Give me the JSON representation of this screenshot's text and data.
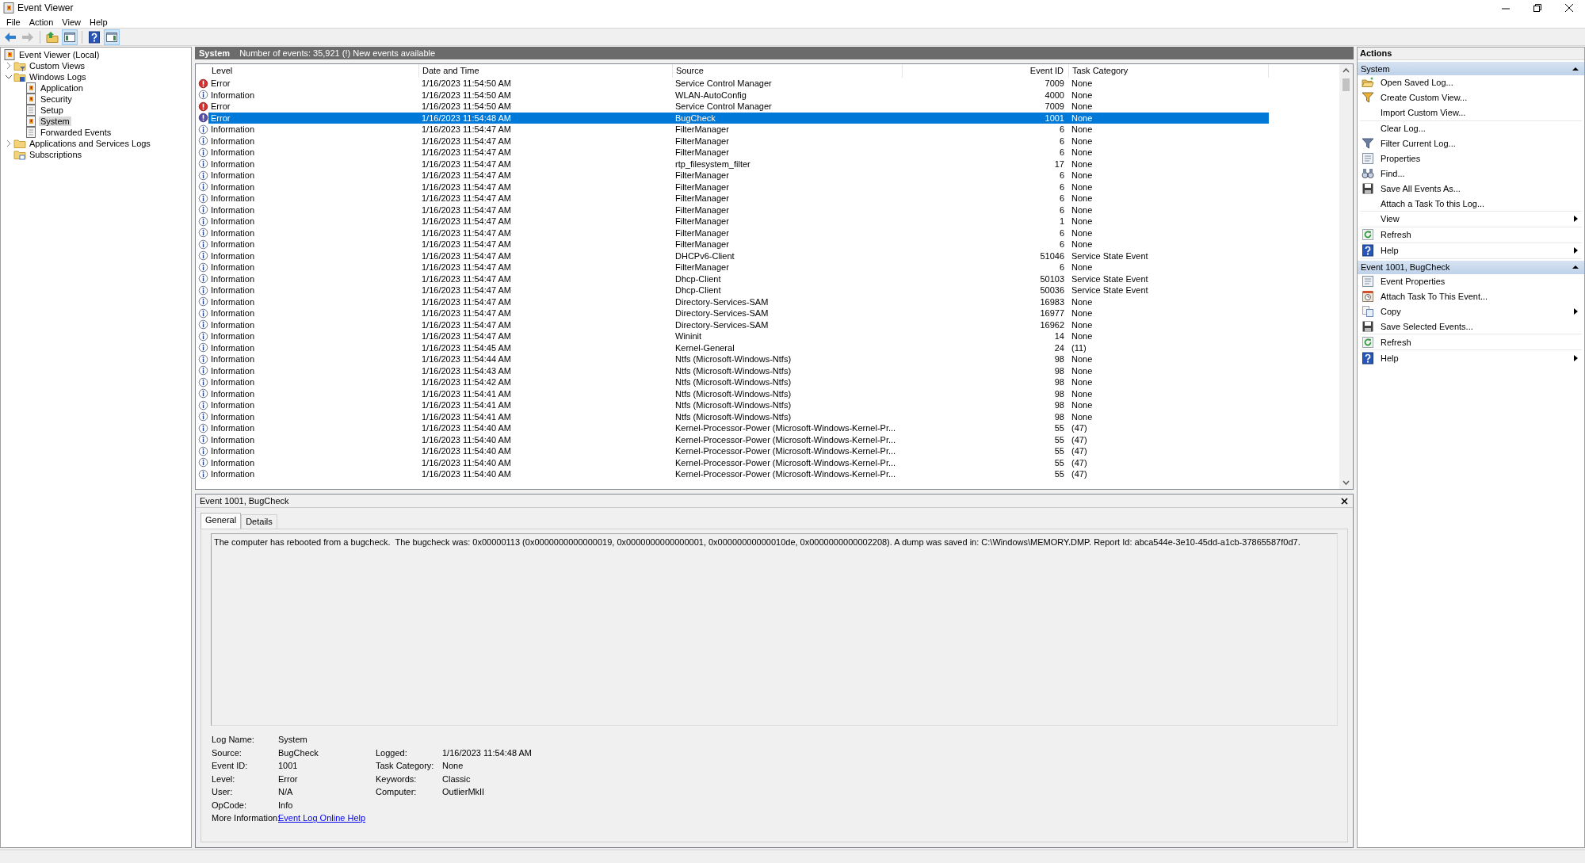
{
  "window": {
    "title": "Event Viewer"
  },
  "menu": [
    {
      "label": "File"
    },
    {
      "label": "Action"
    },
    {
      "label": "View"
    },
    {
      "label": "Help"
    }
  ],
  "toolbar": [
    {
      "kind": "back",
      "disabled": false,
      "pressed": false
    },
    {
      "kind": "forward",
      "disabled": true,
      "pressed": false
    },
    {
      "kind": "up",
      "disabled": false,
      "pressed": false
    },
    {
      "kind": "tree-pane",
      "disabled": false,
      "pressed": true
    },
    {
      "kind": "help",
      "disabled": false,
      "pressed": false
    },
    {
      "kind": "action-pane",
      "disabled": false,
      "pressed": true
    }
  ],
  "tree": {
    "items": [
      {
        "label": "Event Viewer (Local)",
        "kind": "root",
        "selected": false,
        "children": [
          {
            "label": "Custom Views",
            "kind": "filter-folder",
            "selected": false,
            "expanded": false
          },
          {
            "label": "Windows Logs",
            "kind": "logs-folder",
            "selected": false,
            "expanded": true,
            "children": [
              {
                "label": "Application",
                "kind": "log",
                "selected": false
              },
              {
                "label": "Security",
                "kind": "log",
                "selected": false
              },
              {
                "label": "Setup",
                "kind": "plain-log",
                "selected": false
              },
              {
                "label": "System",
                "kind": "log",
                "selected": true
              },
              {
                "label": "Forwarded Events",
                "kind": "plain-log",
                "selected": false
              }
            ]
          },
          {
            "label": "Applications and Services Logs",
            "kind": "folder",
            "selected": false,
            "expanded": false
          },
          {
            "label": "Subscriptions",
            "kind": "subscriptions",
            "selected": false
          }
        ]
      }
    ]
  },
  "events": {
    "title": "System",
    "summary": "Number of events: 35,921 (!) New events available",
    "columns": [
      "Level",
      "Date and Time",
      "Source",
      "Event ID",
      "Task Category"
    ],
    "rows": [
      {
        "kind": "error",
        "level": "Error",
        "date": "1/16/2023 11:54:50 AM",
        "source": "Service Control Manager",
        "event_id": "7009",
        "task_category": "None",
        "selected": false
      },
      {
        "kind": "info",
        "level": "Information",
        "date": "1/16/2023 11:54:50 AM",
        "source": "WLAN-AutoConfig",
        "event_id": "4000",
        "task_category": "None",
        "selected": false
      },
      {
        "kind": "error",
        "level": "Error",
        "date": "1/16/2023 11:54:50 AM",
        "source": "Service Control Manager",
        "event_id": "7009",
        "task_category": "None",
        "selected": false
      },
      {
        "kind": "error",
        "level": "Error",
        "date": "1/16/2023 11:54:48 AM",
        "source": "BugCheck",
        "event_id": "1001",
        "task_category": "None",
        "selected": true
      },
      {
        "kind": "info",
        "level": "Information",
        "date": "1/16/2023 11:54:47 AM",
        "source": "FilterManager",
        "event_id": "6",
        "task_category": "None",
        "selected": false
      },
      {
        "kind": "info",
        "level": "Information",
        "date": "1/16/2023 11:54:47 AM",
        "source": "FilterManager",
        "event_id": "6",
        "task_category": "None",
        "selected": false
      },
      {
        "kind": "info",
        "level": "Information",
        "date": "1/16/2023 11:54:47 AM",
        "source": "FilterManager",
        "event_id": "6",
        "task_category": "None",
        "selected": false
      },
      {
        "kind": "info",
        "level": "Information",
        "date": "1/16/2023 11:54:47 AM",
        "source": "rtp_filesystem_filter",
        "event_id": "17",
        "task_category": "None",
        "selected": false
      },
      {
        "kind": "info",
        "level": "Information",
        "date": "1/16/2023 11:54:47 AM",
        "source": "FilterManager",
        "event_id": "6",
        "task_category": "None",
        "selected": false
      },
      {
        "kind": "info",
        "level": "Information",
        "date": "1/16/2023 11:54:47 AM",
        "source": "FilterManager",
        "event_id": "6",
        "task_category": "None",
        "selected": false
      },
      {
        "kind": "info",
        "level": "Information",
        "date": "1/16/2023 11:54:47 AM",
        "source": "FilterManager",
        "event_id": "6",
        "task_category": "None",
        "selected": false
      },
      {
        "kind": "info",
        "level": "Information",
        "date": "1/16/2023 11:54:47 AM",
        "source": "FilterManager",
        "event_id": "6",
        "task_category": "None",
        "selected": false
      },
      {
        "kind": "info",
        "level": "Information",
        "date": "1/16/2023 11:54:47 AM",
        "source": "FilterManager",
        "event_id": "1",
        "task_category": "None",
        "selected": false
      },
      {
        "kind": "info",
        "level": "Information",
        "date": "1/16/2023 11:54:47 AM",
        "source": "FilterManager",
        "event_id": "6",
        "task_category": "None",
        "selected": false
      },
      {
        "kind": "info",
        "level": "Information",
        "date": "1/16/2023 11:54:47 AM",
        "source": "FilterManager",
        "event_id": "6",
        "task_category": "None",
        "selected": false
      },
      {
        "kind": "info",
        "level": "Information",
        "date": "1/16/2023 11:54:47 AM",
        "source": "DHCPv6-Client",
        "event_id": "51046",
        "task_category": "Service State Event",
        "selected": false
      },
      {
        "kind": "info",
        "level": "Information",
        "date": "1/16/2023 11:54:47 AM",
        "source": "FilterManager",
        "event_id": "6",
        "task_category": "None",
        "selected": false
      },
      {
        "kind": "info",
        "level": "Information",
        "date": "1/16/2023 11:54:47 AM",
        "source": "Dhcp-Client",
        "event_id": "50103",
        "task_category": "Service State Event",
        "selected": false
      },
      {
        "kind": "info",
        "level": "Information",
        "date": "1/16/2023 11:54:47 AM",
        "source": "Dhcp-Client",
        "event_id": "50036",
        "task_category": "Service State Event",
        "selected": false
      },
      {
        "kind": "info",
        "level": "Information",
        "date": "1/16/2023 11:54:47 AM",
        "source": "Directory-Services-SAM",
        "event_id": "16983",
        "task_category": "None",
        "selected": false
      },
      {
        "kind": "info",
        "level": "Information",
        "date": "1/16/2023 11:54:47 AM",
        "source": "Directory-Services-SAM",
        "event_id": "16977",
        "task_category": "None",
        "selected": false
      },
      {
        "kind": "info",
        "level": "Information",
        "date": "1/16/2023 11:54:47 AM",
        "source": "Directory-Services-SAM",
        "event_id": "16962",
        "task_category": "None",
        "selected": false
      },
      {
        "kind": "info",
        "level": "Information",
        "date": "1/16/2023 11:54:47 AM",
        "source": "Wininit",
        "event_id": "14",
        "task_category": "None",
        "selected": false
      },
      {
        "kind": "info",
        "level": "Information",
        "date": "1/16/2023 11:54:45 AM",
        "source": "Kernel-General",
        "event_id": "24",
        "task_category": "(11)",
        "selected": false
      },
      {
        "kind": "info",
        "level": "Information",
        "date": "1/16/2023 11:54:44 AM",
        "source": "Ntfs (Microsoft-Windows-Ntfs)",
        "event_id": "98",
        "task_category": "None",
        "selected": false
      },
      {
        "kind": "info",
        "level": "Information",
        "date": "1/16/2023 11:54:43 AM",
        "source": "Ntfs (Microsoft-Windows-Ntfs)",
        "event_id": "98",
        "task_category": "None",
        "selected": false
      },
      {
        "kind": "info",
        "level": "Information",
        "date": "1/16/2023 11:54:42 AM",
        "source": "Ntfs (Microsoft-Windows-Ntfs)",
        "event_id": "98",
        "task_category": "None",
        "selected": false
      },
      {
        "kind": "info",
        "level": "Information",
        "date": "1/16/2023 11:54:41 AM",
        "source": "Ntfs (Microsoft-Windows-Ntfs)",
        "event_id": "98",
        "task_category": "None",
        "selected": false
      },
      {
        "kind": "info",
        "level": "Information",
        "date": "1/16/2023 11:54:41 AM",
        "source": "Ntfs (Microsoft-Windows-Ntfs)",
        "event_id": "98",
        "task_category": "None",
        "selected": false
      },
      {
        "kind": "info",
        "level": "Information",
        "date": "1/16/2023 11:54:41 AM",
        "source": "Ntfs (Microsoft-Windows-Ntfs)",
        "event_id": "98",
        "task_category": "None",
        "selected": false
      },
      {
        "kind": "info",
        "level": "Information",
        "date": "1/16/2023 11:54:40 AM",
        "source": "Kernel-Processor-Power (Microsoft-Windows-Kernel-Pr...",
        "event_id": "55",
        "task_category": "(47)",
        "selected": false
      },
      {
        "kind": "info",
        "level": "Information",
        "date": "1/16/2023 11:54:40 AM",
        "source": "Kernel-Processor-Power (Microsoft-Windows-Kernel-Pr...",
        "event_id": "55",
        "task_category": "(47)",
        "selected": false
      },
      {
        "kind": "info",
        "level": "Information",
        "date": "1/16/2023 11:54:40 AM",
        "source": "Kernel-Processor-Power (Microsoft-Windows-Kernel-Pr...",
        "event_id": "55",
        "task_category": "(47)",
        "selected": false
      },
      {
        "kind": "info",
        "level": "Information",
        "date": "1/16/2023 11:54:40 AM",
        "source": "Kernel-Processor-Power (Microsoft-Windows-Kernel-Pr...",
        "event_id": "55",
        "task_category": "(47)",
        "selected": false
      },
      {
        "kind": "info",
        "level": "Information",
        "date": "1/16/2023 11:54:40 AM",
        "source": "Kernel-Processor-Power (Microsoft-Windows-Kernel-Pr...",
        "event_id": "55",
        "task_category": "(47)",
        "selected": false
      }
    ]
  },
  "details": {
    "title": "Event 1001, BugCheck",
    "tabs": [
      {
        "label": "General",
        "selected": true
      },
      {
        "label": "Details",
        "selected": false
      }
    ],
    "description": "The computer has rebooted from a bugcheck.  The bugcheck was: 0x00000113 (0x0000000000000019, 0x0000000000000001, 0x00000000000010de, 0x0000000000002208). A dump was saved in: C:\\Windows\\MEMORY.DMP. Report Id: abca544e-3e10-45dd-a1cb-37865587f0d7.",
    "left_fields": [
      {
        "label": "Log Name:",
        "value": "System"
      },
      {
        "label": "Source:",
        "value": "BugCheck"
      },
      {
        "label": "Event ID:",
        "value": "1001"
      },
      {
        "label": "Level:",
        "value": "Error"
      },
      {
        "label": "User:",
        "value": "N/A"
      },
      {
        "label": "OpCode:",
        "value": "Info"
      }
    ],
    "right_fields": [
      {
        "label": "Logged:",
        "value": "1/16/2023 11:54:48 AM"
      },
      {
        "label": "Task Category:",
        "value": "None"
      },
      {
        "label": "Keywords:",
        "value": "Classic"
      },
      {
        "label": "Computer:",
        "value": "OutlierMkII"
      }
    ],
    "more_info": {
      "label": "More Information:",
      "link": "Event Log Online Help"
    }
  },
  "actions": {
    "title": "Actions",
    "sections": [
      {
        "title": "System",
        "expanded": true,
        "groups": [
          [
            {
              "label": "Open Saved Log...",
              "kind": "open",
              "submenu": false
            },
            {
              "label": "Create Custom View...",
              "kind": "filter",
              "submenu": false
            },
            {
              "label": "Import Custom View...",
              "kind": "none",
              "submenu": false
            }
          ],
          [
            {
              "label": "Clear Log...",
              "kind": "none",
              "submenu": false
            },
            {
              "label": "Filter Current Log...",
              "kind": "filter-plain",
              "submenu": false
            },
            {
              "label": "Properties",
              "kind": "properties",
              "submenu": false
            },
            {
              "label": "Find...",
              "kind": "find",
              "submenu": false
            },
            {
              "label": "Save All Events As...",
              "kind": "save",
              "submenu": false
            },
            {
              "label": "Attach a Task To this Log...",
              "kind": "none",
              "submenu": false
            }
          ],
          [
            {
              "label": "View",
              "kind": "none",
              "submenu": true
            }
          ],
          [
            {
              "label": "Refresh",
              "kind": "refresh",
              "submenu": false
            }
          ],
          [
            {
              "label": "Help",
              "kind": "help",
              "submenu": true
            }
          ]
        ]
      },
      {
        "title": "Event 1001, BugCheck",
        "expanded": true,
        "groups": [
          [
            {
              "label": "Event Properties",
              "kind": "properties",
              "submenu": false
            },
            {
              "label": "Attach Task To This Event...",
              "kind": "task",
              "submenu": false
            },
            {
              "label": "Copy",
              "kind": "copy",
              "submenu": true
            },
            {
              "label": "Save Selected Events...",
              "kind": "save",
              "submenu": false
            }
          ],
          [
            {
              "label": "Refresh",
              "kind": "refresh",
              "submenu": false
            }
          ],
          [
            {
              "label": "Help",
              "kind": "help",
              "submenu": true
            }
          ]
        ]
      }
    ]
  }
}
